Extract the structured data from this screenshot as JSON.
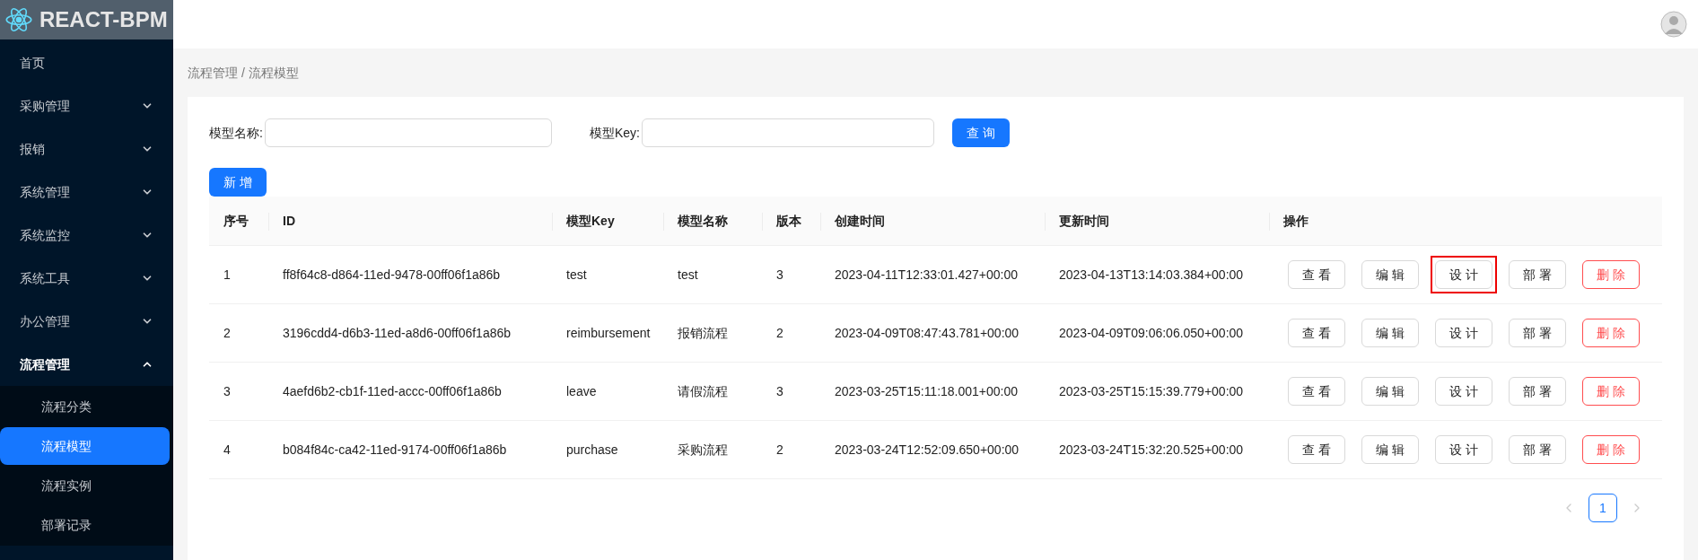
{
  "logo": {
    "title": "REACT-BPM"
  },
  "sidebar": {
    "items": [
      {
        "label": "首页",
        "expandable": false,
        "expanded": false,
        "selected": false
      },
      {
        "label": "采购管理",
        "expandable": true,
        "expanded": false,
        "selected": false
      },
      {
        "label": "报销",
        "expandable": true,
        "expanded": false,
        "selected": false
      },
      {
        "label": "系统管理",
        "expandable": true,
        "expanded": false,
        "selected": false
      },
      {
        "label": "系统监控",
        "expandable": true,
        "expanded": false,
        "selected": false
      },
      {
        "label": "系统工具",
        "expandable": true,
        "expanded": false,
        "selected": false
      },
      {
        "label": "办公管理",
        "expandable": true,
        "expanded": false,
        "selected": false
      },
      {
        "label": "流程管理",
        "expandable": true,
        "expanded": true,
        "selected": false,
        "children": [
          {
            "label": "流程分类",
            "selected": false
          },
          {
            "label": "流程模型",
            "selected": true
          },
          {
            "label": "流程实例",
            "selected": false
          },
          {
            "label": "部署记录",
            "selected": false
          }
        ]
      }
    ]
  },
  "breadcrumb": [
    "流程管理",
    "/",
    "流程模型"
  ],
  "filters": [
    {
      "label": "模型名称:"
    },
    {
      "label": "模型Key:"
    }
  ],
  "search_button": "查 询",
  "add_button": "新 增",
  "table": {
    "columns": [
      "序号",
      "ID",
      "模型Key",
      "模型名称",
      "版本",
      "创建时间",
      "更新时间",
      "操作"
    ],
    "rows": [
      {
        "cells": [
          "1",
          "ff8f64c8-d864-11ed-9478-00ff06f1a86b",
          "test",
          "test",
          "3",
          "2023-04-11T12:33:01.427+00:00",
          "2023-04-13T13:14:03.384+00:00"
        ],
        "actions": [
          {
            "label": "查 看",
            "kind": "default",
            "highlighted": false
          },
          {
            "label": "编 辑",
            "kind": "default",
            "highlighted": false
          },
          {
            "label": "设 计",
            "kind": "default",
            "highlighted": true
          },
          {
            "label": "部 署",
            "kind": "default",
            "highlighted": false
          },
          {
            "label": "删 除",
            "kind": "danger",
            "highlighted": false
          }
        ]
      },
      {
        "cells": [
          "2",
          "3196cdd4-d6b3-11ed-a8d6-00ff06f1a86b",
          "reimbursement",
          "报销流程",
          "2",
          "2023-04-09T08:47:43.781+00:00",
          "2023-04-09T09:06:06.050+00:00"
        ],
        "actions": [
          {
            "label": "查 看",
            "kind": "default",
            "highlighted": false
          },
          {
            "label": "编 辑",
            "kind": "default",
            "highlighted": false
          },
          {
            "label": "设 计",
            "kind": "default",
            "highlighted": false
          },
          {
            "label": "部 署",
            "kind": "default",
            "highlighted": false
          },
          {
            "label": "删 除",
            "kind": "danger",
            "highlighted": false
          }
        ]
      },
      {
        "cells": [
          "3",
          "4aefd6b2-cb1f-11ed-accc-00ff06f1a86b",
          "leave",
          "请假流程",
          "3",
          "2023-03-25T15:11:18.001+00:00",
          "2023-03-25T15:15:39.779+00:00"
        ],
        "actions": [
          {
            "label": "查 看",
            "kind": "default",
            "highlighted": false
          },
          {
            "label": "编 辑",
            "kind": "default",
            "highlighted": false
          },
          {
            "label": "设 计",
            "kind": "default",
            "highlighted": false
          },
          {
            "label": "部 署",
            "kind": "default",
            "highlighted": false
          },
          {
            "label": "删 除",
            "kind": "danger",
            "highlighted": false
          }
        ]
      },
      {
        "cells": [
          "4",
          "b084f84c-ca42-11ed-9174-00ff06f1a86b",
          "purchase",
          "采购流程",
          "2",
          "2023-03-24T12:52:09.650+00:00",
          "2023-03-24T15:32:20.525+00:00"
        ],
        "actions": [
          {
            "label": "查 看",
            "kind": "default",
            "highlighted": false
          },
          {
            "label": "编 辑",
            "kind": "default",
            "highlighted": false
          },
          {
            "label": "设 计",
            "kind": "default",
            "highlighted": false
          },
          {
            "label": "部 署",
            "kind": "default",
            "highlighted": false
          },
          {
            "label": "删 除",
            "kind": "danger",
            "highlighted": false
          }
        ]
      }
    ]
  },
  "pagination": {
    "pages": [
      {
        "label": "1",
        "selected": true
      }
    ]
  }
}
